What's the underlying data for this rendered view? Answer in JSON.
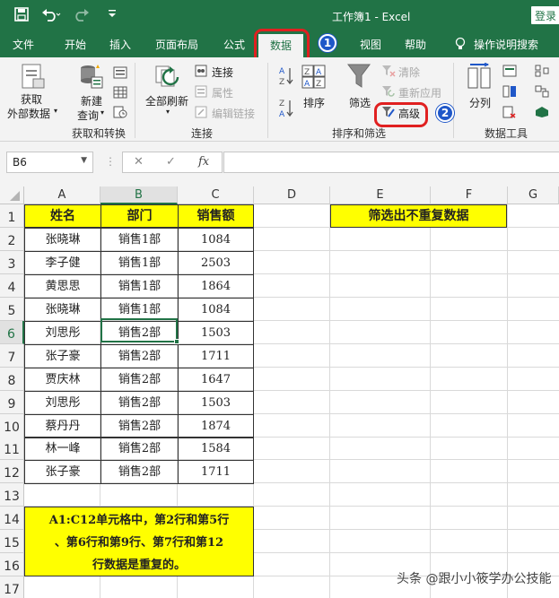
{
  "titlebar": {
    "title": "工作簿1 - Excel",
    "login": "登录",
    "save_icon": "save-icon",
    "undo_icon": "undo-icon",
    "redo_icon": "redo-icon",
    "customize_icon": "quick-access-customize-icon"
  },
  "tabs": [
    "文件",
    "开始",
    "插入",
    "页面布局",
    "公式",
    "数据",
    "视图",
    "帮助",
    "操作说明搜索"
  ],
  "active_tab": "数据",
  "markers": [
    "1",
    "2"
  ],
  "ribbon": {
    "get_data": {
      "line1": "获取",
      "line2": "外部数据"
    },
    "new_query": {
      "line1": "新建",
      "line2": "查询"
    },
    "group1_label": "获取和转换",
    "refresh_all": "全部刷新",
    "connections": "连接",
    "properties": "属性",
    "edit_links": "编辑链接",
    "group2_label": "连接",
    "sort": "排序",
    "filter": "筛选",
    "clear": "清除",
    "reapply": "重新应用",
    "advanced": "高级",
    "group3_label": "排序和筛选",
    "text_to_columns": "分列",
    "group4_label": "数据工具"
  },
  "formula_bar": {
    "name_box": "B6",
    "fx": "fx",
    "cancel_icon": "cancel-icon",
    "enter_icon": "check-icon",
    "value": ""
  },
  "columns": [
    "A",
    "B",
    "C",
    "D",
    "E",
    "F",
    "G"
  ],
  "rows": [
    "1",
    "2",
    "3",
    "4",
    "5",
    "6",
    "7",
    "8",
    "9",
    "10",
    "11",
    "12",
    "13",
    "14",
    "15",
    "16",
    "17"
  ],
  "table": {
    "headers": [
      "姓名",
      "部门",
      "销售额"
    ],
    "data": [
      [
        "张晓琳",
        "销售1部",
        "1084"
      ],
      [
        "李子健",
        "销售1部",
        "2503"
      ],
      [
        "黄思思",
        "销售1部",
        "1864"
      ],
      [
        "张晓琳",
        "销售1部",
        "1084"
      ],
      [
        "刘思彤",
        "销售2部",
        "1503"
      ],
      [
        "张子豪",
        "销售2部",
        "1711"
      ],
      [
        "贾庆林",
        "销售2部",
        "1647"
      ],
      [
        "刘思彤",
        "销售2部",
        "1503"
      ],
      [
        "蔡丹丹",
        "销售2部",
        "1874"
      ],
      [
        "林一峰",
        "销售2部",
        "1584"
      ],
      [
        "张子豪",
        "销售2部",
        "1711"
      ]
    ]
  },
  "e1_label": "筛选出不重复数据",
  "note": {
    "line1": "A1:C12单元格中，第2行和第5行",
    "line2": "、第6行和第9行、第7行和第12",
    "line3": "行数据是重复的。"
  },
  "watermark": "头条 @跟小小筱学办公技能",
  "colors": {
    "excel_green": "#217346",
    "highlight_yellow": "#ffff00",
    "marker_red": "#e02020",
    "badge_blue": "#1f57c8"
  }
}
